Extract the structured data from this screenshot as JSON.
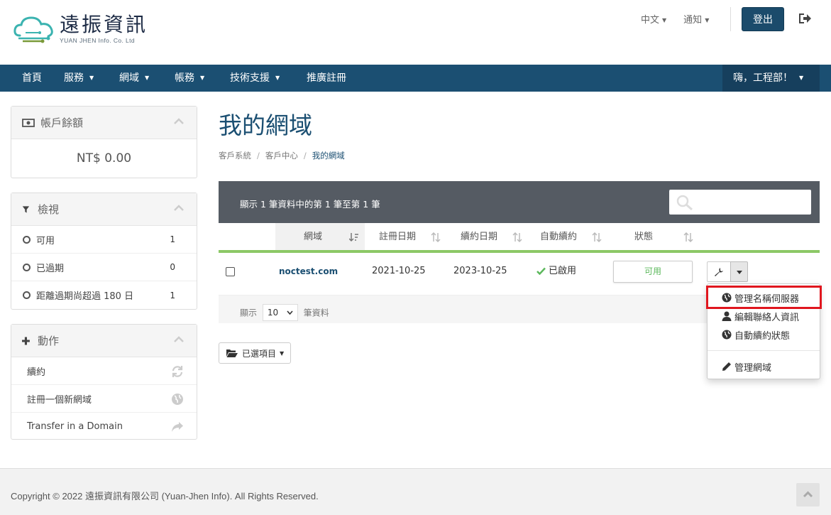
{
  "brand": {
    "name": "遠振資訊",
    "subtitle": "YUAN JHEN Info. Co. Ltd"
  },
  "topbar": {
    "language": "中文",
    "notifications": "通知",
    "logout": "登出",
    "exit_icon": "sign-out-icon"
  },
  "nav": {
    "items": [
      {
        "label": "首頁",
        "has_dropdown": false
      },
      {
        "label": "服務",
        "has_dropdown": true
      },
      {
        "label": "網域",
        "has_dropdown": true
      },
      {
        "label": "帳務",
        "has_dropdown": true
      },
      {
        "label": "技術支援",
        "has_dropdown": true
      },
      {
        "label": "推廣註冊",
        "has_dropdown": false
      }
    ],
    "user_greeting": "嗨，工程部！"
  },
  "sidebar": {
    "balance": {
      "title": "帳戶餘額",
      "value": "NT$ 0.00"
    },
    "view": {
      "title": "檢視",
      "filters": [
        {
          "label": "可用",
          "count": "1"
        },
        {
          "label": "已過期",
          "count": "0"
        },
        {
          "label": "距離過期尚超過 180 日",
          "count": "1"
        }
      ]
    },
    "actions": {
      "title": "動作",
      "items": [
        {
          "label": "續約",
          "icon": "refresh-icon"
        },
        {
          "label": "註冊一個新網域",
          "icon": "globe-icon"
        },
        {
          "label": "Transfer in a Domain",
          "icon": "share-icon"
        }
      ]
    }
  },
  "main": {
    "title": "我的網域",
    "breadcrumb": [
      "客戶系統",
      "客戶中心",
      "我的網域"
    ],
    "table_info": "顯示 1 筆資料中的第 1 筆至第 1 筆",
    "search_placeholder": "",
    "columns": [
      "網域",
      "註冊日期",
      "續約日期",
      "自動續約",
      "狀態"
    ],
    "rows": [
      {
        "domain": "noctest.com",
        "reg_date": "2021-10-25",
        "renew_date": "2023-10-25",
        "auto_renew": "已啟用",
        "status": "可用"
      }
    ],
    "footer": {
      "show": "顯示",
      "page_length": "10",
      "suffix": "筆資料"
    },
    "selected_button": "已選項目"
  },
  "dropdown_menu": {
    "items": [
      {
        "label": "管理名稱伺服器",
        "icon": "globe-icon"
      },
      {
        "label": "編輯聯絡人資訊",
        "icon": "user-icon"
      },
      {
        "label": "自動續約狀態",
        "icon": "globe-icon"
      },
      {
        "label": "管理網域",
        "icon": "pencil-icon"
      }
    ],
    "highlight_color": "#e0161e"
  },
  "footer": {
    "copyright": "Copyright © 2022 遠振資訊有限公司 (Yuan-Jhen Info). All Rights Reserved."
  },
  "colors": {
    "primary": "#1b4f72",
    "accent_green": "#8cc866",
    "table_bar": "#555b63"
  }
}
